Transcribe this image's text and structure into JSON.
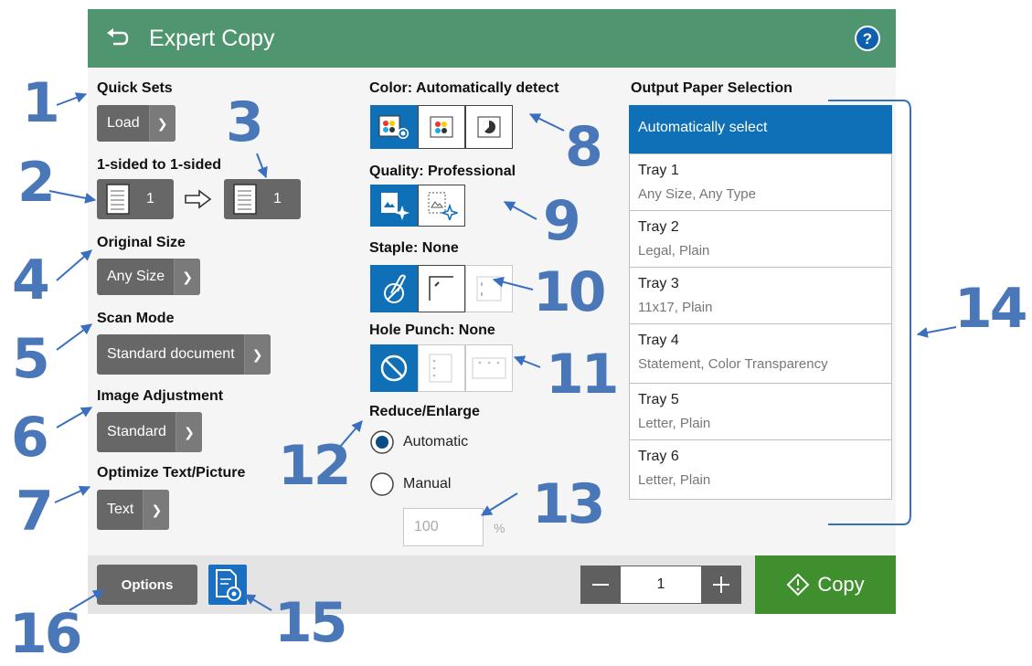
{
  "header": {
    "title": "Expert Copy",
    "back_icon": "back-arrow-icon",
    "help_icon": "help-icon",
    "color": "#4f9570"
  },
  "quick_sets": {
    "label": "Quick Sets",
    "button": "Load"
  },
  "sides": {
    "label": "1-sided to 1-sided",
    "input_count": "1",
    "output_count": "1"
  },
  "original_size": {
    "label": "Original Size",
    "button": "Any Size"
  },
  "scan_mode": {
    "label": "Scan Mode",
    "button": "Standard document"
  },
  "image_adjustment": {
    "label": "Image Adjustment",
    "button": "Standard"
  },
  "optimize": {
    "label": "Optimize Text/Picture",
    "button": "Text"
  },
  "color": {
    "label": "Color: Automatically detect",
    "options": [
      "auto-color-icon",
      "color-icon",
      "black-white-icon"
    ],
    "selected": 0
  },
  "quality": {
    "label": "Quality: Professional",
    "options": [
      "professional-quality-icon",
      "general-office-icon"
    ],
    "selected": 0
  },
  "staple": {
    "label": "Staple: None",
    "options": [
      "no-staple-icon",
      "staple-top-left-icon",
      "staple-left-icon"
    ],
    "selected": 0
  },
  "hole_punch": {
    "label": "Hole Punch: None",
    "options": [
      "no-punch-icon",
      "punch-left-icon",
      "punch-top-icon"
    ],
    "selected": 0
  },
  "reduce_enlarge": {
    "label": "Reduce/Enlarge",
    "automatic": "Automatic",
    "manual": "Manual",
    "selected": "Automatic",
    "percent_value": "100",
    "percent_unit": "%"
  },
  "output_paper": {
    "label": "Output Paper Selection",
    "auto": "Automatically select",
    "trays": [
      {
        "name": "Tray 1",
        "desc": "Any Size, Any Type"
      },
      {
        "name": "Tray 2",
        "desc": "Legal, Plain"
      },
      {
        "name": "Tray 3",
        "desc": "11x17, Plain"
      },
      {
        "name": "Tray 4",
        "desc": "Statement, Color Transparency"
      },
      {
        "name": "Tray 5",
        "desc": "Letter, Plain"
      },
      {
        "name": "Tray 6",
        "desc": "Letter, Plain"
      }
    ],
    "accent": "#0f70b7"
  },
  "footer": {
    "options": "Options",
    "copies": "1",
    "copy": "Copy",
    "copy_color": "#3f8f2f"
  },
  "callouts": [
    "1",
    "2",
    "3",
    "4",
    "5",
    "6",
    "7",
    "8",
    "9",
    "10",
    "11",
    "12",
    "13",
    "14",
    "15",
    "16"
  ],
  "callout_color": "#4a77b7"
}
